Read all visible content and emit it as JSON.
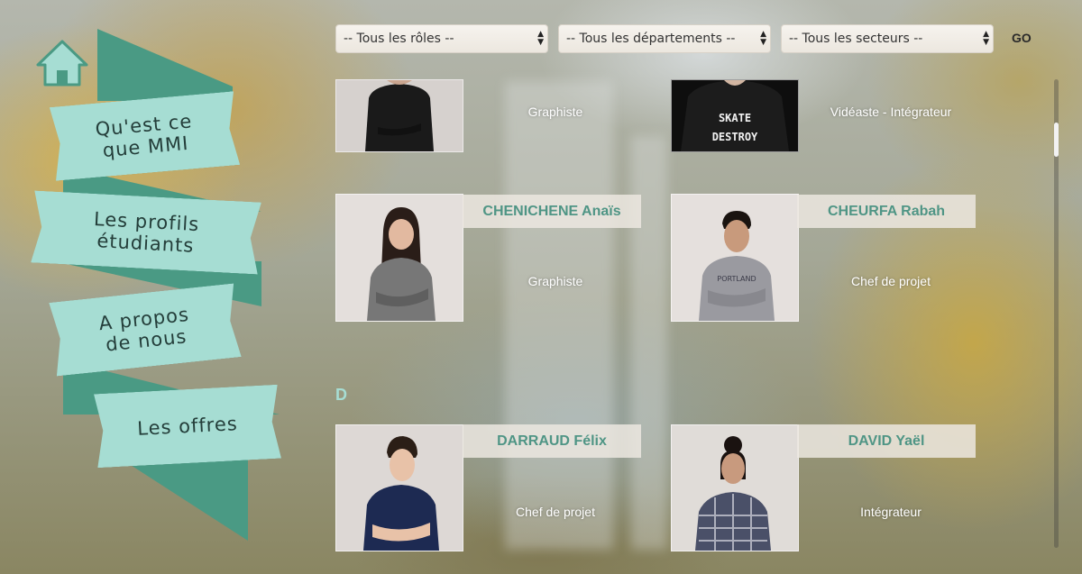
{
  "nav": {
    "home_icon": "home-icon",
    "items": [
      {
        "label_line1": "Qu'est ce",
        "label_line2": "que MMI"
      },
      {
        "label_line1": "Les profils",
        "label_line2": "étudiants"
      },
      {
        "label_line1": "A propos",
        "label_line2": "de nous"
      },
      {
        "label_line1": "Les offres",
        "label_line2": ""
      }
    ],
    "ribbon_color": "#a6ddd3",
    "ribbon_tail_color": "#4a9a84"
  },
  "filters": {
    "roles": "-- Tous les rôles --",
    "departements": "-- Tous les départements --",
    "secteurs": "-- Tous les secteurs --",
    "go": "GO"
  },
  "profiles": {
    "row1": [
      {
        "name": "",
        "role": "Graphiste"
      },
      {
        "name": "",
        "role": "Vidéaste - Intégrateur",
        "shirt_text_1": "SKATE",
        "shirt_text_2": "DESTROY"
      }
    ],
    "row2": [
      {
        "name": "CHENICHENE Anaïs",
        "role": "Graphiste"
      },
      {
        "name": "CHEURFA Rabah",
        "role": "Chef de projet"
      }
    ],
    "section_letter": "D",
    "row3": [
      {
        "name": "DARRAUD Félix",
        "role": "Chef de projet"
      },
      {
        "name": "DAVID Yaël",
        "role": "Intégrateur"
      }
    ]
  },
  "colors": {
    "accent": "#4f9585",
    "name_bar_bg": "#ece8e0"
  }
}
